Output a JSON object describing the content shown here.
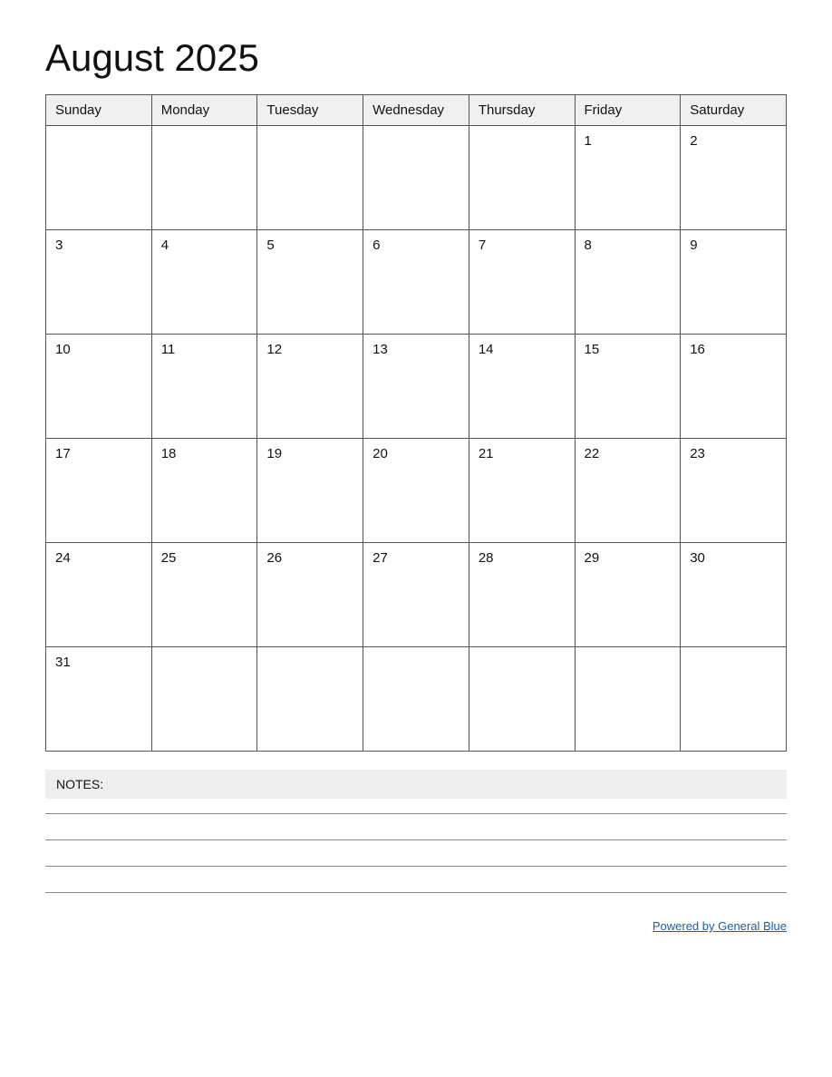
{
  "header": {
    "title": "August 2025"
  },
  "calendar": {
    "days_of_week": [
      "Sunday",
      "Monday",
      "Tuesday",
      "Wednesday",
      "Thursday",
      "Friday",
      "Saturday"
    ],
    "weeks": [
      [
        {
          "day": "",
          "empty": true
        },
        {
          "day": "",
          "empty": true
        },
        {
          "day": "",
          "empty": true
        },
        {
          "day": "",
          "empty": true
        },
        {
          "day": "",
          "empty": true
        },
        {
          "day": "1",
          "empty": false
        },
        {
          "day": "2",
          "empty": false
        }
      ],
      [
        {
          "day": "3",
          "empty": false
        },
        {
          "day": "4",
          "empty": false
        },
        {
          "day": "5",
          "empty": false
        },
        {
          "day": "6",
          "empty": false
        },
        {
          "day": "7",
          "empty": false
        },
        {
          "day": "8",
          "empty": false
        },
        {
          "day": "9",
          "empty": false
        }
      ],
      [
        {
          "day": "10",
          "empty": false
        },
        {
          "day": "11",
          "empty": false
        },
        {
          "day": "12",
          "empty": false
        },
        {
          "day": "13",
          "empty": false
        },
        {
          "day": "14",
          "empty": false
        },
        {
          "day": "15",
          "empty": false
        },
        {
          "day": "16",
          "empty": false
        }
      ],
      [
        {
          "day": "17",
          "empty": false
        },
        {
          "day": "18",
          "empty": false
        },
        {
          "day": "19",
          "empty": false
        },
        {
          "day": "20",
          "empty": false
        },
        {
          "day": "21",
          "empty": false
        },
        {
          "day": "22",
          "empty": false
        },
        {
          "day": "23",
          "empty": false
        }
      ],
      [
        {
          "day": "24",
          "empty": false
        },
        {
          "day": "25",
          "empty": false
        },
        {
          "day": "26",
          "empty": false
        },
        {
          "day": "27",
          "empty": false
        },
        {
          "day": "28",
          "empty": false
        },
        {
          "day": "29",
          "empty": false
        },
        {
          "day": "30",
          "empty": false
        }
      ],
      [
        {
          "day": "31",
          "empty": false
        },
        {
          "day": "",
          "empty": true
        },
        {
          "day": "",
          "empty": true
        },
        {
          "day": "",
          "empty": true
        },
        {
          "day": "",
          "empty": true
        },
        {
          "day": "",
          "empty": true
        },
        {
          "day": "",
          "empty": true
        }
      ]
    ]
  },
  "notes": {
    "label": "NOTES:",
    "line_count": 4
  },
  "footer": {
    "link_text": "Powered by General Blue",
    "link_url": "#"
  }
}
